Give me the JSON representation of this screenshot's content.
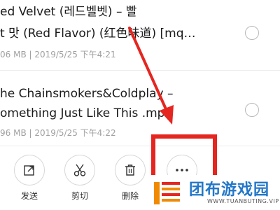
{
  "files": [
    {
      "name_line1": "ed Velvet (레드벨벳) – 빨",
      "name_line2": "t 맛 (Red Flavor) (红色味道) [mq…",
      "meta": "06 MB | 2019/5/25 下午4:21"
    },
    {
      "name_line1": "he Chainsmokers&Coldplay –",
      "name_line2": "omething Just Like This .mp3",
      "meta": "96 MB | 2019/5/25 下午4:22"
    }
  ],
  "toolbar": {
    "send_label": "发送",
    "cut_label": "剪切",
    "delete_label": "删除",
    "more_icon": "more-icon"
  },
  "watermark": {
    "title": "团布游戏园",
    "subtitle": "WWW.TUANBUTING.VIP"
  },
  "colors": {
    "annotation": "#e52520",
    "watermark_blue": "#2277c8",
    "watermark_orange": "#f08a00"
  }
}
